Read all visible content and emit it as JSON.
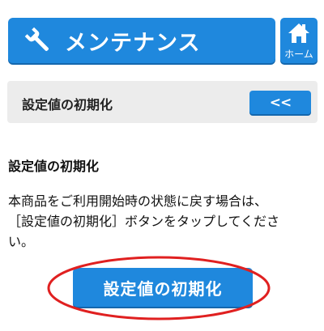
{
  "header": {
    "title": "メンテナンス",
    "icon": "wrench-icon",
    "home_label": "ホーム",
    "home_icon": "home-icon"
  },
  "section": {
    "title": "設定値の初期化",
    "back_label": "<<"
  },
  "content": {
    "heading": "設定値の初期化",
    "lines": [
      "本商品をご利用開始時の状態に戻す場合は、",
      "［設定値の初期化］ボタンをタップしてくださ",
      "い。"
    ],
    "button_label": "設定値の初期化"
  },
  "colors": {
    "accent": "#1f88dd",
    "panel": "#ececec",
    "highlight": "#e02020"
  }
}
